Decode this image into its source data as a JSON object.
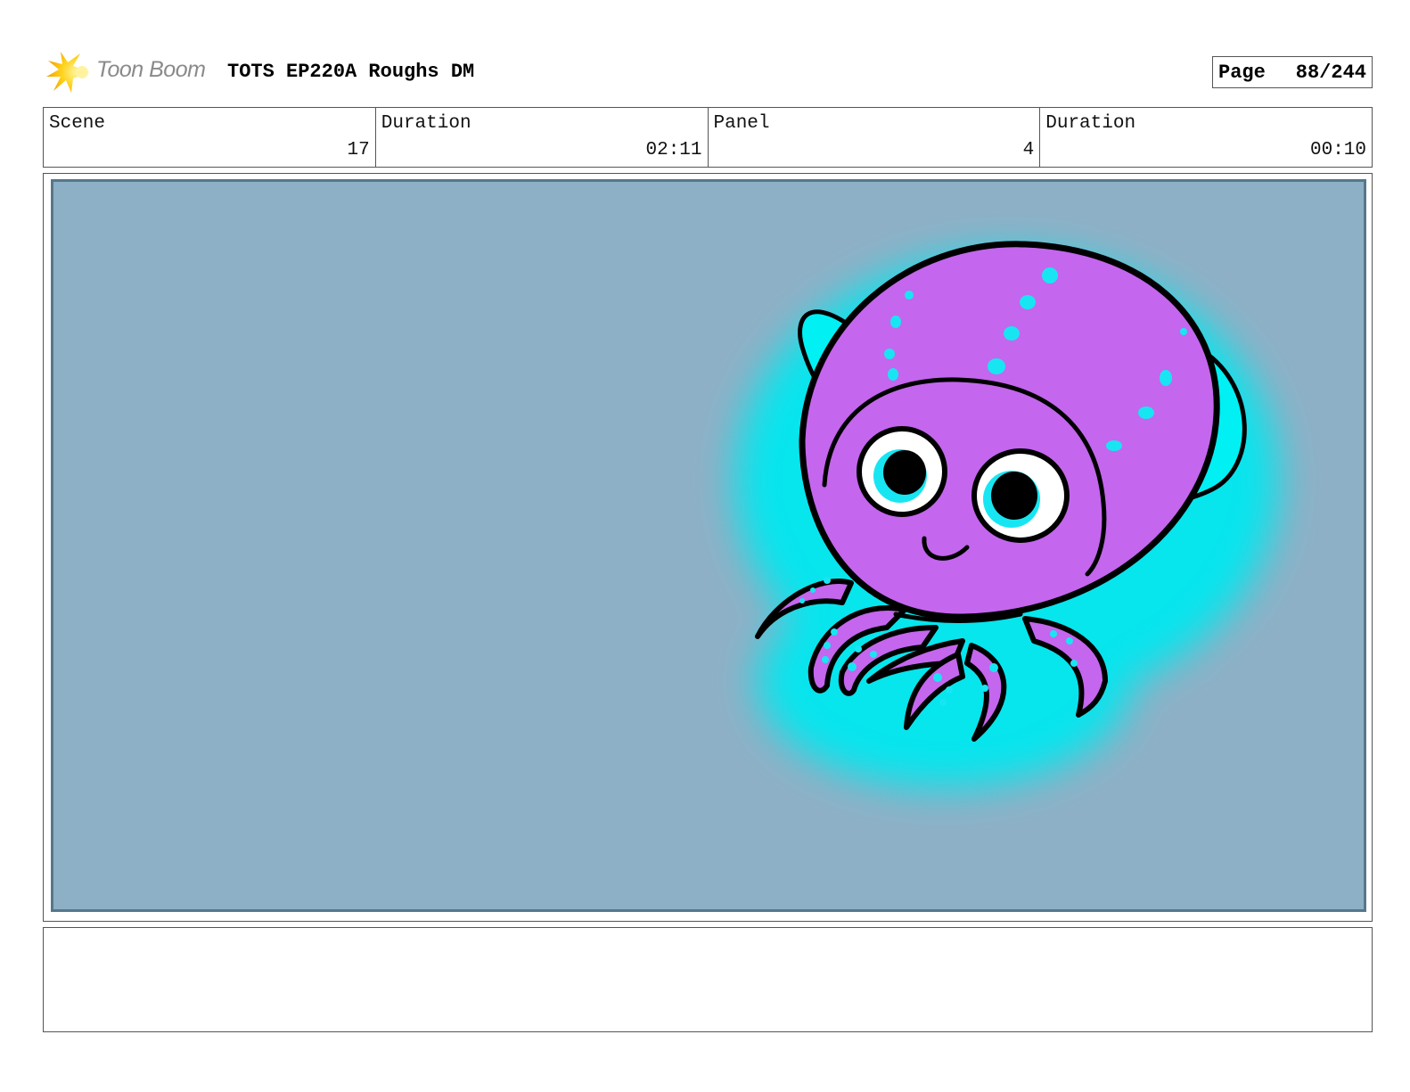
{
  "header": {
    "logo_text": "Toon Boom",
    "logo_icon": "toon-boom-star-icon",
    "title": "TOTS EP220A Roughs DM",
    "page_label": "Page",
    "page_value": "88/244"
  },
  "info": {
    "scene_label": "Scene",
    "scene_value": "17",
    "scene_duration_label": "Duration",
    "scene_duration_value": "02:11",
    "panel_label": "Panel",
    "panel_value": "4",
    "panel_duration_label": "Duration",
    "panel_duration_value": "00:10"
  },
  "panel": {
    "illustration": "octopus-character",
    "colors": {
      "background": "#8eb0c6",
      "glow": "#00e8f0",
      "body": "#c466ee",
      "spots": "#17e6f2",
      "outline": "#000000"
    }
  },
  "notes": {
    "text": ""
  }
}
